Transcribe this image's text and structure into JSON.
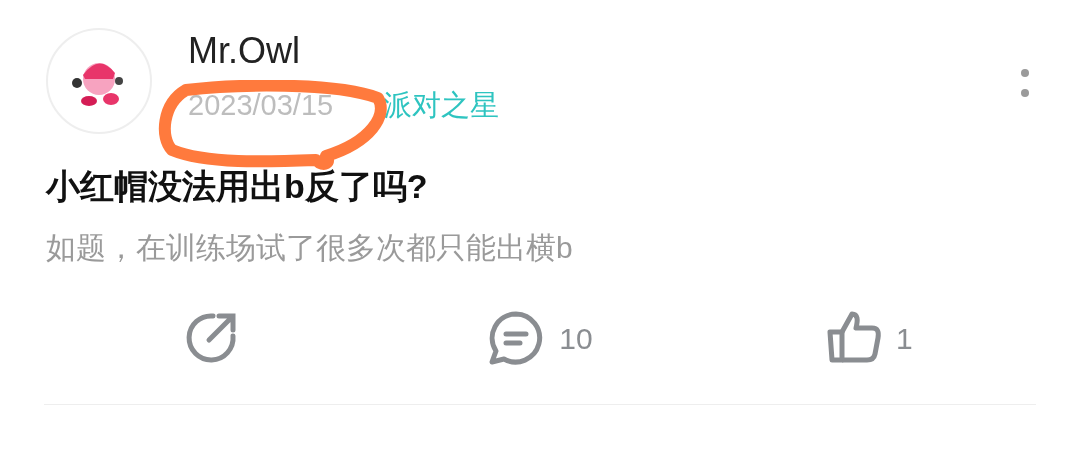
{
  "post": {
    "author": "Mr.Owl",
    "date": "2023/03/15",
    "tag": "派对之星",
    "title": "小红帽没法用出b反了吗?",
    "body": "如题，在训练场试了很多次都只能出横b"
  },
  "actions": [
    {
      "kind": "share"
    },
    {
      "kind": "comment",
      "count": "10"
    },
    {
      "kind": "like",
      "count": "1"
    }
  ]
}
